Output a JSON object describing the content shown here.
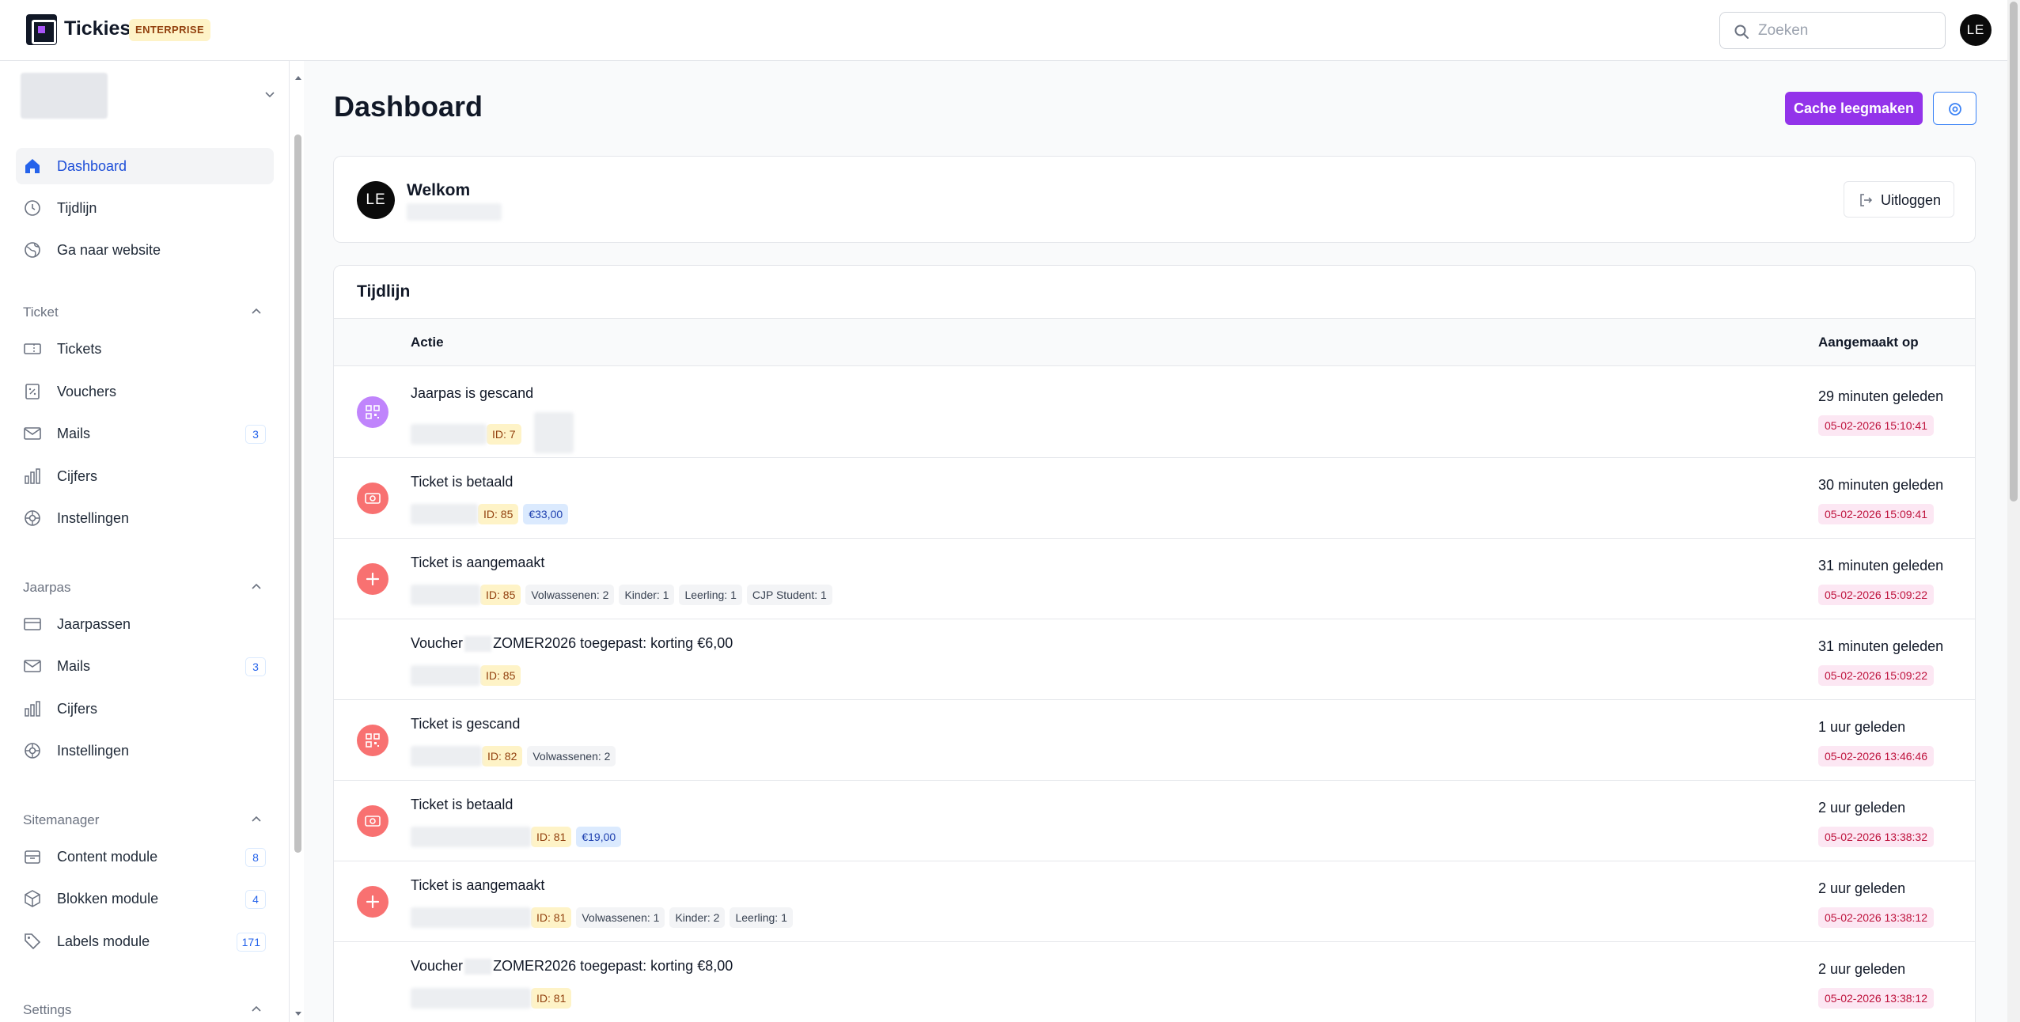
{
  "header": {
    "brand": "Tickies",
    "edition": "ENTERPRISE",
    "search_placeholder": "Zoeken",
    "user_initials": "LE"
  },
  "sidebar": {
    "top": [
      {
        "label": "Dashboard",
        "icon": "home-icon",
        "active": true
      },
      {
        "label": "Tijdlijn",
        "icon": "clock-icon"
      },
      {
        "label": "Ga naar website",
        "icon": "globe-icon"
      }
    ],
    "sections": [
      {
        "title": "Ticket",
        "items": [
          {
            "label": "Tickets",
            "icon": "ticket-icon"
          },
          {
            "label": "Vouchers",
            "icon": "voucher-icon"
          },
          {
            "label": "Mails",
            "icon": "mail-icon",
            "badge": "3"
          },
          {
            "label": "Cijfers",
            "icon": "chart-icon"
          },
          {
            "label": "Instellingen",
            "icon": "settings-icon"
          }
        ]
      },
      {
        "title": "Jaarpas",
        "items": [
          {
            "label": "Jaarpassen",
            "icon": "card-icon"
          },
          {
            "label": "Mails",
            "icon": "mail-icon",
            "badge": "3"
          },
          {
            "label": "Cijfers",
            "icon": "chart-icon"
          },
          {
            "label": "Instellingen",
            "icon": "settings-icon"
          }
        ]
      },
      {
        "title": "Sitemanager",
        "items": [
          {
            "label": "Content module",
            "icon": "archive-icon",
            "badge": "8"
          },
          {
            "label": "Blokken module",
            "icon": "cube-icon",
            "badge": "4"
          },
          {
            "label": "Labels module",
            "icon": "tag-icon",
            "badge": "171"
          }
        ]
      },
      {
        "title": "Settings",
        "items": []
      }
    ]
  },
  "main": {
    "title": "Dashboard",
    "cache_button": "Cache leegmaken",
    "welcome": {
      "title": "Welkom",
      "initials": "LE",
      "logout": "Uitloggen"
    },
    "timeline": {
      "title": "Tijdlijn",
      "col_action": "Actie",
      "col_date": "Aangemaakt op",
      "rows": [
        {
          "icon": "qr-icon",
          "color": "#c084fc",
          "title": "Jaarpas is gescand",
          "tags": [
            {
              "type": "id",
              "text": "ID: 7"
            }
          ],
          "relative": "29 minuten geleden",
          "date": "05-02-2026 15:10:41"
        },
        {
          "icon": "money-icon",
          "color": "#f87171",
          "title": "Ticket is betaald",
          "tags": [
            {
              "type": "id",
              "text": "ID: 85"
            },
            {
              "type": "price",
              "text": "€33,00"
            }
          ],
          "relative": "30 minuten geleden",
          "date": "05-02-2026 15:09:41"
        },
        {
          "icon": "plus-icon",
          "color": "#f87171",
          "title": "Ticket is aangemaakt",
          "tags": [
            {
              "type": "id",
              "text": "ID: 85"
            },
            {
              "type": "grey",
              "text": "Volwassenen: 2"
            },
            {
              "type": "grey",
              "text": "Kinder: 1"
            },
            {
              "type": "grey",
              "text": "Leerling: 1"
            },
            {
              "type": "grey",
              "text": "CJP Student: 1"
            }
          ],
          "relative": "31 minuten geleden",
          "date": "05-02-2026 15:09:22"
        },
        {
          "icon": "",
          "color": "",
          "title_pre": "Voucher",
          "title_post": "ZOMER2026 toegepast: korting €6,00",
          "tags": [
            {
              "type": "id",
              "text": "ID: 85"
            }
          ],
          "relative": "31 minuten geleden",
          "date": "05-02-2026 15:09:22"
        },
        {
          "icon": "qr-icon",
          "color": "#f87171",
          "title": "Ticket is gescand",
          "tags": [
            {
              "type": "id",
              "text": "ID: 82"
            },
            {
              "type": "grey",
              "text": "Volwassenen: 2"
            }
          ],
          "relative": "1 uur geleden",
          "date": "05-02-2026 13:46:46"
        },
        {
          "icon": "money-icon",
          "color": "#f87171",
          "title": "Ticket is betaald",
          "tags": [
            {
              "type": "id",
              "text": "ID: 81"
            },
            {
              "type": "price",
              "text": "€19,00"
            }
          ],
          "relative": "2 uur geleden",
          "date": "05-02-2026 13:38:32"
        },
        {
          "icon": "plus-icon",
          "color": "#f87171",
          "title": "Ticket is aangemaakt",
          "tags": [
            {
              "type": "id",
              "text": "ID: 81"
            },
            {
              "type": "grey",
              "text": "Volwassenen: 1"
            },
            {
              "type": "grey",
              "text": "Kinder: 2"
            },
            {
              "type": "grey",
              "text": "Leerling: 1"
            }
          ],
          "relative": "2 uur geleden",
          "date": "05-02-2026 13:38:12"
        },
        {
          "icon": "",
          "color": "",
          "title_pre": "Voucher",
          "title_post": "ZOMER2026 toegepast: korting €8,00",
          "tags": [
            {
              "type": "id",
              "text": "ID: 81"
            }
          ],
          "relative": "2 uur geleden",
          "date": "05-02-2026 13:38:12"
        }
      ]
    }
  }
}
